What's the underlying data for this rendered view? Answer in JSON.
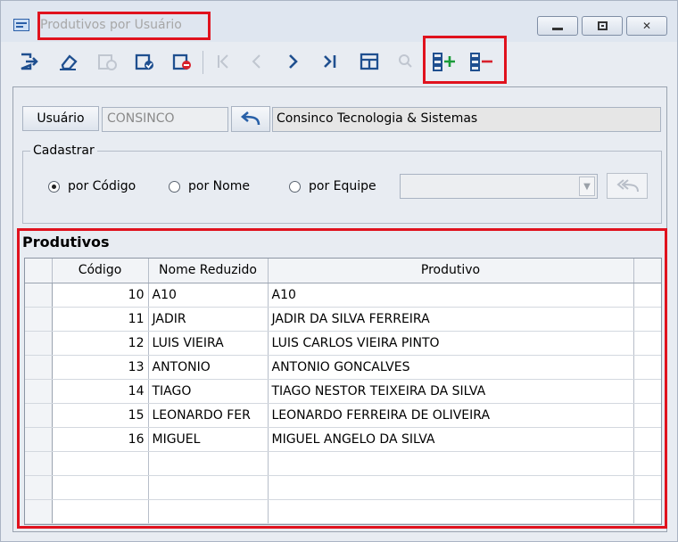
{
  "window": {
    "title": "Produtivos por Usuário",
    "controls": {
      "minimize": "—",
      "maximize": "□",
      "close": "✕"
    }
  },
  "toolbar": {
    "buttons": [
      {
        "icon": "exit-icon",
        "glyph": "➜"
      },
      {
        "icon": "eraser-icon",
        "glyph": "◇"
      },
      {
        "icon": "new-record-icon",
        "glyph": "⊕",
        "disabled": true
      },
      {
        "icon": "save-check-icon",
        "glyph": "✔"
      },
      {
        "icon": "delete-icon",
        "glyph": "⊖"
      },
      {
        "icon": "first-record-icon",
        "glyph": "|<",
        "disabled": true
      },
      {
        "icon": "previous-record-icon",
        "glyph": "<",
        "disabled": true
      },
      {
        "icon": "next-record-icon",
        "glyph": ">"
      },
      {
        "icon": "last-record-icon",
        "glyph": ">|"
      },
      {
        "icon": "grid-view-icon",
        "glyph": "▦"
      },
      {
        "icon": "search-icon",
        "glyph": "⚲",
        "disabled": true
      },
      {
        "icon": "add-row-icon",
        "glyph": "☰+"
      },
      {
        "icon": "remove-row-icon",
        "glyph": "☰−"
      }
    ],
    "accent_color": "#1f4f8f",
    "highlight_color": "#e0121e"
  },
  "user": {
    "button_label": "Usuário",
    "code_value": "CONSINCO",
    "company_name": "Consinco Tecnologia & Sistemas"
  },
  "cadastrar": {
    "label": "Cadastrar",
    "options": [
      {
        "label": "por Código",
        "selected": true
      },
      {
        "label": "por Nome",
        "selected": false
      },
      {
        "label": "por Equipe",
        "selected": false
      }
    ],
    "equipe_value": ""
  },
  "grid": {
    "title": "Produtivos",
    "columns": [
      "Código",
      "Nome Reduzido",
      "Produtivo"
    ],
    "rows": [
      [
        "10",
        "A10",
        "A10"
      ],
      [
        "11",
        "JADIR",
        "JADIR DA SILVA FERREIRA"
      ],
      [
        "12",
        "LUIS VIEIRA",
        "LUIS CARLOS VIEIRA PINTO"
      ],
      [
        "13",
        "ANTONIO",
        "ANTONIO GONCALVES"
      ],
      [
        "14",
        "TIAGO",
        "TIAGO NESTOR TEIXEIRA DA SILVA"
      ],
      [
        "15",
        "LEONARDO FER",
        "LEONARDO FERREIRA DE OLIVEIRA"
      ],
      [
        "16",
        "MIGUEL",
        "MIGUEL ANGELO DA SILVA"
      ]
    ]
  }
}
